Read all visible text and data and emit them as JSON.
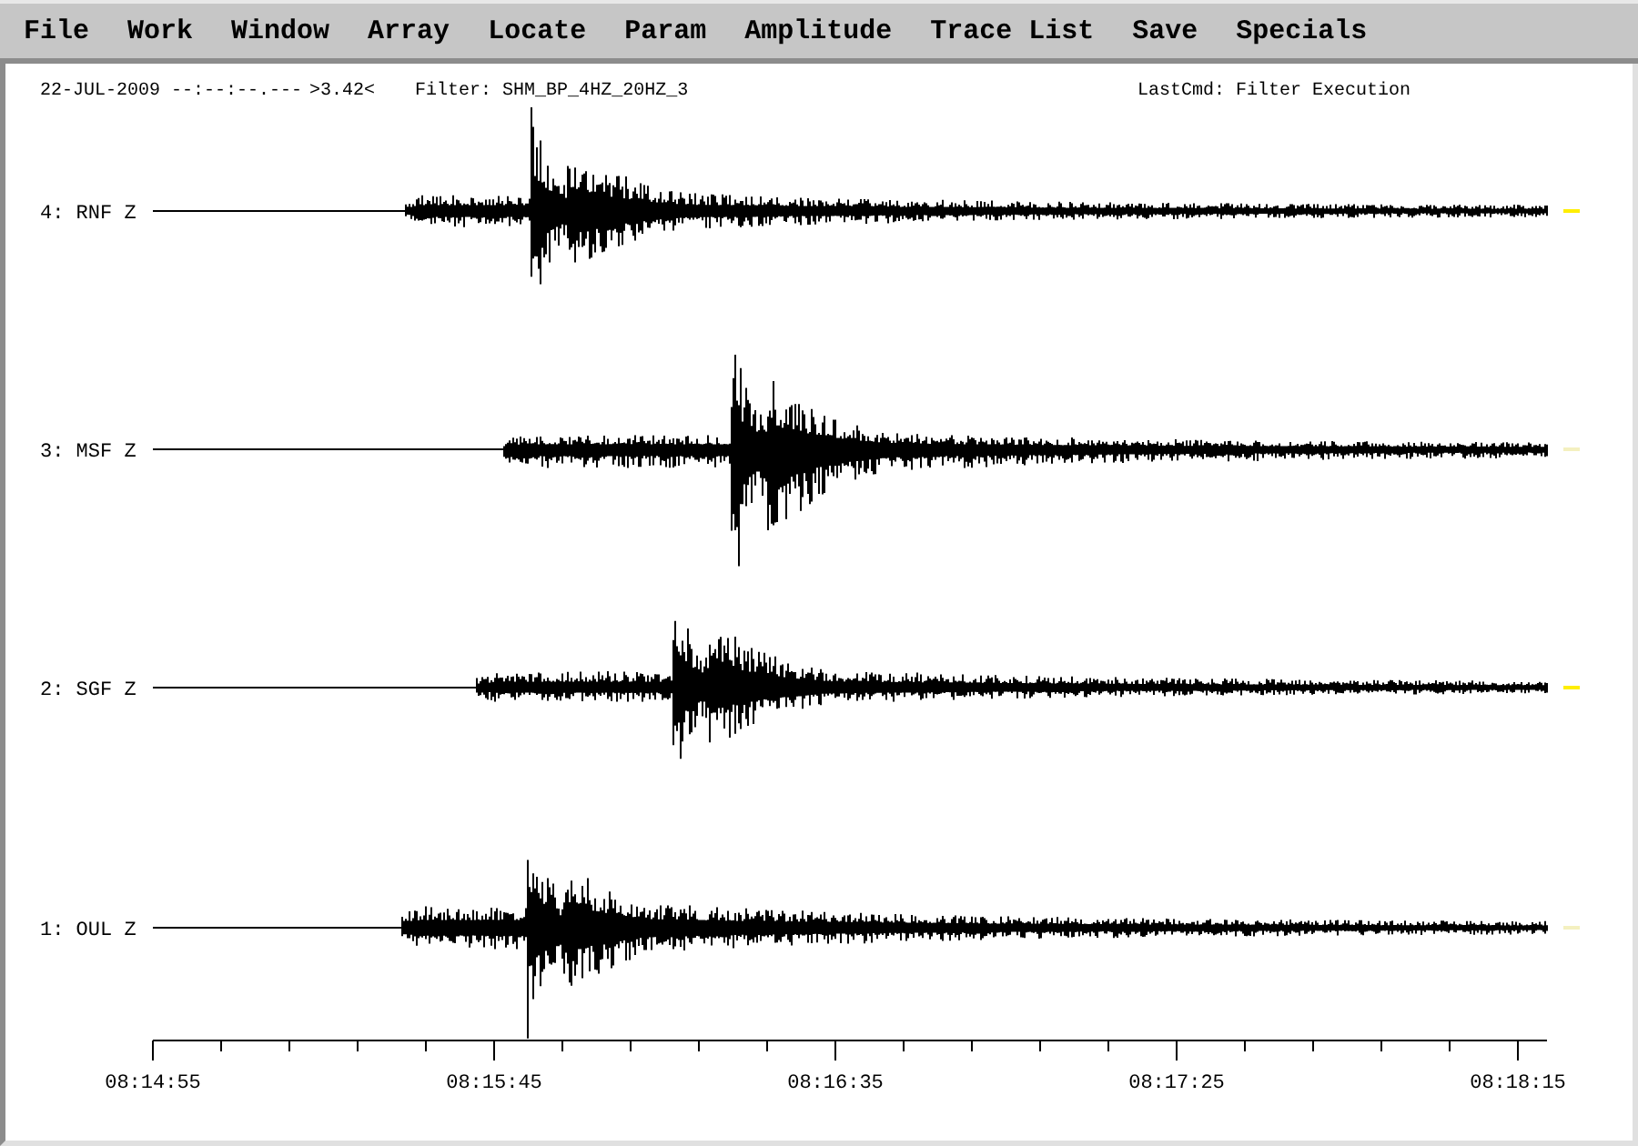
{
  "menu": [
    {
      "label": "File"
    },
    {
      "label": "Work"
    },
    {
      "label": "Window"
    },
    {
      "label": "Array"
    },
    {
      "label": "Locate"
    },
    {
      "label": "Param"
    },
    {
      "label": "Amplitude"
    },
    {
      "label": "Trace List"
    },
    {
      "label": "Save"
    },
    {
      "label": "Specials"
    }
  ],
  "status": {
    "time": "22-JUL-2009 --:--:--.---",
    "scale": ">3.42<",
    "filter": "Filter: SHM_BP_4HZ_20HZ_3",
    "last_cmd": "LastCmd: Filter Execution"
  },
  "traces": [
    {
      "label": "4: RNF Z"
    },
    {
      "label": "3: MSF Z"
    },
    {
      "label": "2: SGF Z"
    },
    {
      "label": "1: OUL Z"
    }
  ],
  "time_axis": {
    "ticks": [
      "08:14:55",
      "08:15:45",
      "08:16:35",
      "08:17:25",
      "08:18:15"
    ]
  }
}
